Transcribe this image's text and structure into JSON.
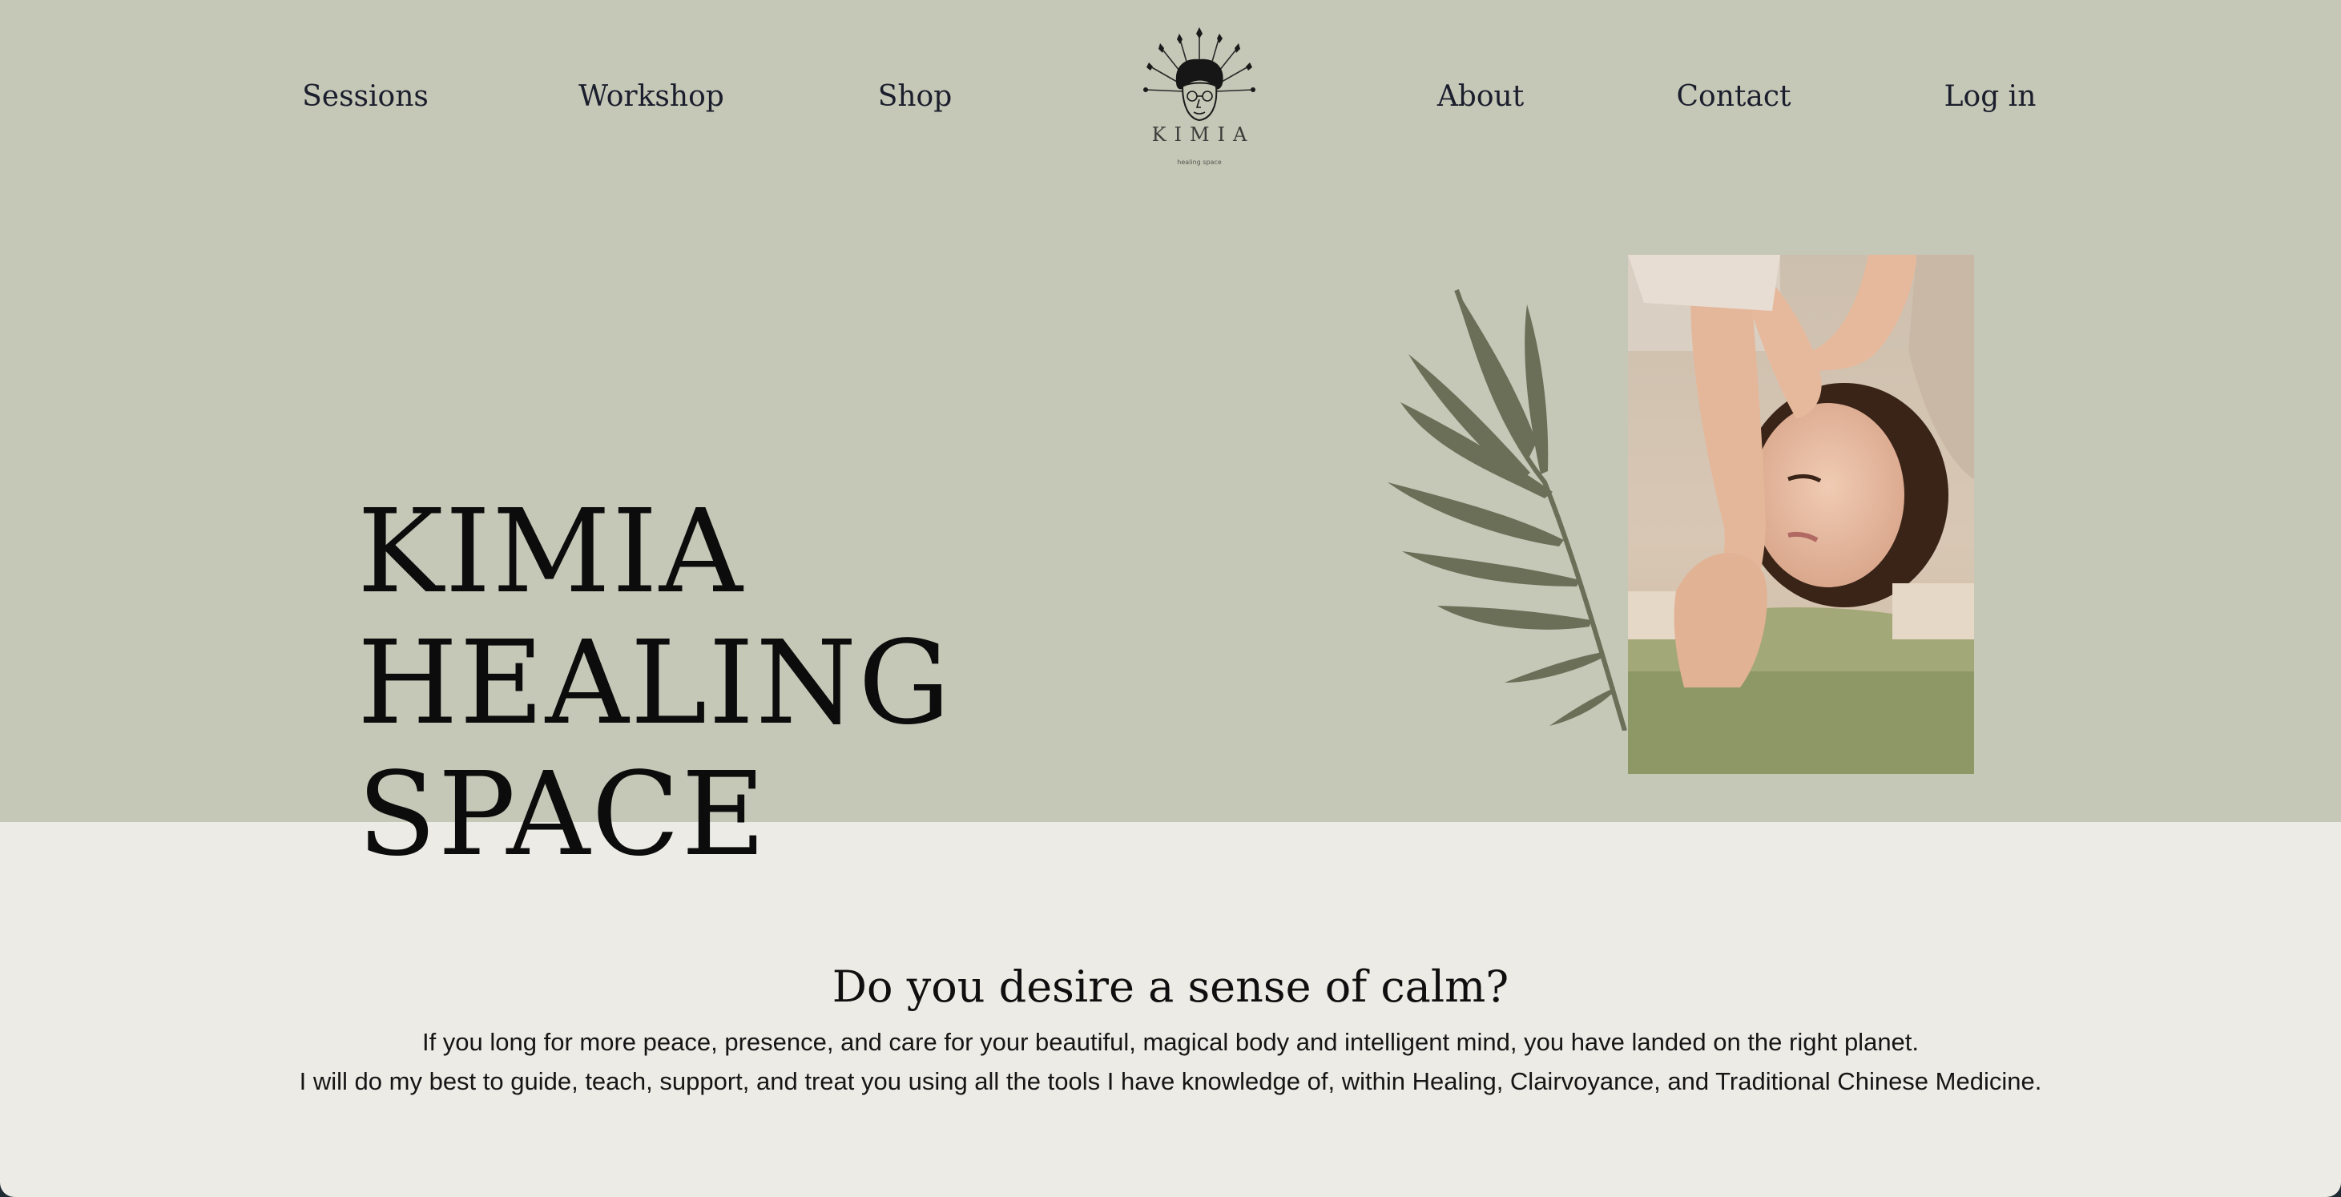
{
  "nav": {
    "left": [
      "Sessions",
      "Workshop",
      "Shop"
    ],
    "right": [
      "About",
      "Contact",
      "Log in"
    ]
  },
  "logo": {
    "wordmark": "KIMIA",
    "tagline": "healing space"
  },
  "hero": {
    "title_lines": [
      "KIMIA",
      "HEALING",
      "SPACE"
    ],
    "image": "healing-session-photo"
  },
  "intro": {
    "heading": "Do you desire a sense of calm?",
    "lines": [
      "If you long for more peace, presence, and care for your beautiful, magical body and intelligent mind, you have landed on the right planet.",
      "I will do my best to guide, teach, support, and treat you using all the tools I have knowledge of, within Healing, Clairvoyance, and Traditional Chinese Medicine."
    ]
  },
  "colors": {
    "hero_bg": "#c5c7b7",
    "page_bg": "#edebe5",
    "leaf": "#6b6f58",
    "text": "#0c0c0c"
  }
}
